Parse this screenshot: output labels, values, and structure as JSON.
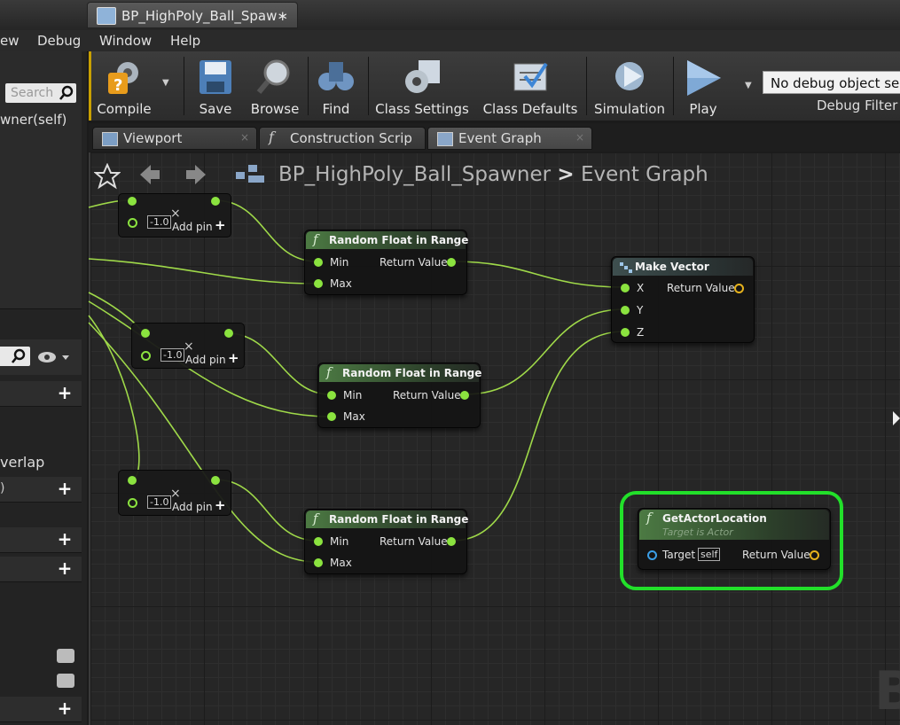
{
  "document_tab": {
    "title": "BP_HighPoly_Ball_Spaw∗"
  },
  "menu": {
    "items": [
      "ew",
      "Debug",
      "Window",
      "Help"
    ]
  },
  "left_panel": {
    "search_placeholder": "Search",
    "function_item": "wner(self)",
    "event_item": "verlap",
    "paren_item": ")"
  },
  "toolbar": {
    "buttons": [
      {
        "label": "Compile",
        "icon": "compile-icon"
      },
      {
        "label": "Save",
        "icon": "save-icon"
      },
      {
        "label": "Browse",
        "icon": "browse-icon"
      },
      {
        "label": "Find",
        "icon": "find-icon"
      },
      {
        "label": "Class Settings",
        "icon": "class-settings-icon"
      },
      {
        "label": "Class Defaults",
        "icon": "class-defaults-icon"
      },
      {
        "label": "Simulation",
        "icon": "simulation-icon"
      },
      {
        "label": "Play",
        "icon": "play-icon"
      }
    ],
    "debug_object": "No debug object sele",
    "debug_filter_label": "Debug Filter"
  },
  "editor_tabs": [
    {
      "label": "Viewport"
    },
    {
      "label": "Construction Scrip"
    },
    {
      "label": "Event Graph"
    }
  ],
  "breadcrumb": {
    "blueprint": "BP_HighPoly_Ball_Spawner",
    "separator": ">",
    "graph": "Event Graph"
  },
  "graph": {
    "make_array_nodes": [
      {
        "value": "-1.0",
        "add_pin": "Add pin"
      },
      {
        "value": "-1.0",
        "add_pin": "Add pin"
      },
      {
        "value": "-1.0",
        "add_pin": "Add pin"
      }
    ],
    "random_nodes": [
      {
        "title": "Random Float in Range",
        "min": "Min",
        "max": "Max",
        "ret": "Return Value"
      },
      {
        "title": "Random Float in Range",
        "min": "Min",
        "max": "Max",
        "ret": "Return Value"
      },
      {
        "title": "Random Float in Range",
        "min": "Min",
        "max": "Max",
        "ret": "Return Value"
      }
    ],
    "make_vector": {
      "title": "Make Vector",
      "x": "X",
      "y": "Y",
      "z": "Z",
      "ret": "Return Value"
    },
    "get_actor_location": {
      "title": "GetActorLocation",
      "subtitle": "Target is Actor",
      "target": "Target",
      "self": "self",
      "ret": "Return Value"
    },
    "highlight_color": "#22e02a",
    "wire_color": "#9fd949"
  }
}
